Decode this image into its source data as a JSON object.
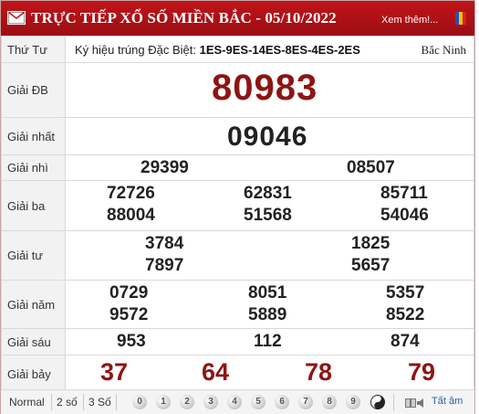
{
  "header": {
    "title": "TRỰC TIẾP XỔ SỐ MIỀN BẮC - 05/10/2022",
    "more_link": "Xem thêm!...",
    "colors": {
      "bar": "#b01217",
      "prize_red": "#8e1414"
    }
  },
  "info_row": {
    "day": "Thứ Tư",
    "kyhieu_label": "Ký hiệu trúng Đặc Biệt:",
    "kyhieu_value": "1ES-9ES-14ES-8ES-4ES-2ES",
    "province": "Bắc Ninh"
  },
  "prizes": {
    "db": {
      "label": "Giải ĐB",
      "values": [
        "80983"
      ]
    },
    "nhat": {
      "label": "Giải nhất",
      "values": [
        "09046"
      ]
    },
    "nhi": {
      "label": "Giải nhì",
      "values": [
        "29399",
        "08507"
      ]
    },
    "ba": {
      "label": "Giải ba",
      "values": [
        "72726",
        "62831",
        "85711",
        "88004",
        "51568",
        "54046"
      ]
    },
    "tu": {
      "label": "Giải tư",
      "values": [
        "3784",
        "1825",
        "7897",
        "5657"
      ]
    },
    "nam": {
      "label": "Giải năm",
      "values": [
        "0729",
        "8051",
        "5357",
        "9572",
        "5889",
        "8522"
      ]
    },
    "sau": {
      "label": "Giải sáu",
      "values": [
        "953",
        "112",
        "874"
      ]
    },
    "bay": {
      "label": "Giải bảy",
      "values": [
        "37",
        "64",
        "78",
        "79"
      ]
    }
  },
  "footer": {
    "modes": [
      "Normal",
      "2 số",
      "3 Số"
    ],
    "digits": [
      "0",
      "1",
      "2",
      "3",
      "4",
      "5",
      "6",
      "7",
      "8",
      "9"
    ],
    "all_label": "Tất âm",
    "icons": [
      "yin-yang-icon",
      "speaker-icon"
    ]
  }
}
